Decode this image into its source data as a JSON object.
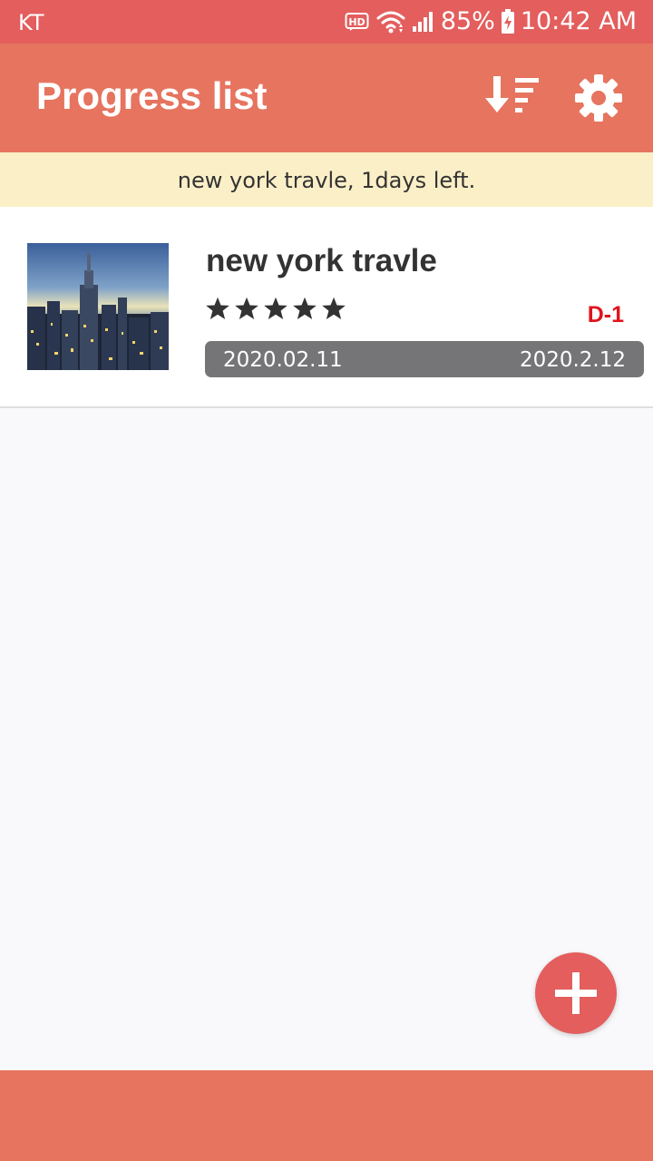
{
  "status_bar": {
    "carrier": "KT",
    "hd_label": "HD",
    "battery_percent": "85%",
    "time": "10:42 AM",
    "icons": [
      "hd-icon",
      "wifi-icon",
      "signal-icon",
      "battery-charging-icon"
    ]
  },
  "app_bar": {
    "title": "Progress list",
    "sort_icon": "sort-descending-icon",
    "settings_icon": "gear-icon"
  },
  "notice": {
    "text": "new york travle, 1days left."
  },
  "items": [
    {
      "title": "new york travle",
      "rating": 5,
      "rating_max": 5,
      "dday": "D-1",
      "start_date": "2020.02.11",
      "end_date": "2020.2.12",
      "thumbnail": "city-skyline-photo"
    }
  ],
  "fab": {
    "icon": "plus-icon"
  },
  "colors": {
    "status_bar": "#e35e5d",
    "app_bar": "#e6745f",
    "notice_bg": "#fbefc7",
    "dday": "#e0141c",
    "progress_bar": "#757577",
    "fab": "#e35e5d"
  }
}
